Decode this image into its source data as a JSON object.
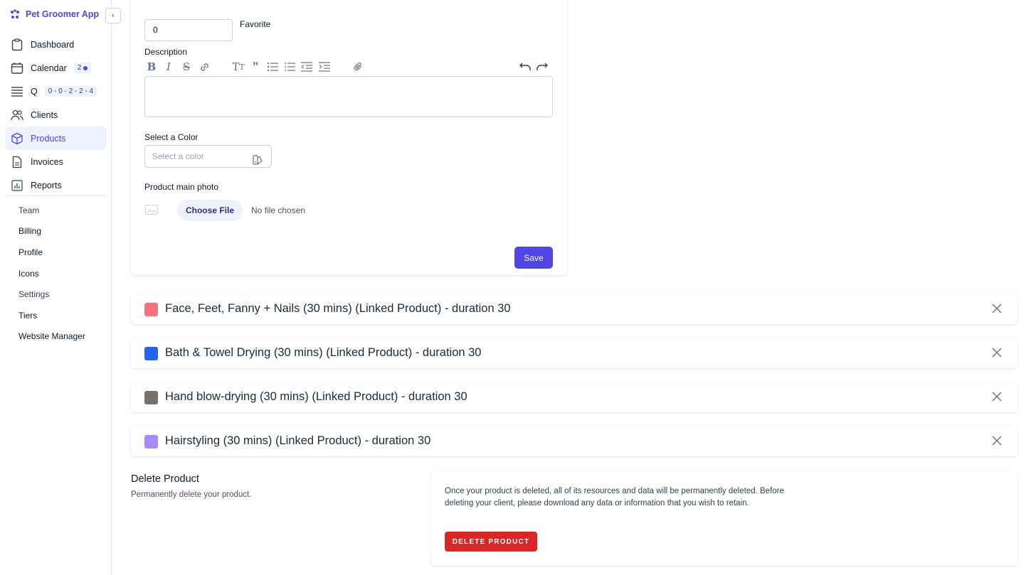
{
  "app": {
    "title": "Pet Groomer App",
    "collapse_icon": "chevron-left-icon",
    "brand_color": "#4f46e5"
  },
  "nav": {
    "items": [
      {
        "label": "Dashboard",
        "icon": "clipboard-icon"
      },
      {
        "label": "Calendar",
        "icon": "calendar-icon",
        "badge": "2"
      },
      {
        "label": "Q",
        "icon": "queue-icon",
        "badge": "0 - 0 - 2 - 2 - 4"
      },
      {
        "label": "Clients",
        "icon": "users-icon"
      },
      {
        "label": "Products",
        "icon": "cube-icon",
        "active": true
      },
      {
        "label": "Invoices",
        "icon": "document-icon"
      },
      {
        "label": "Reports",
        "icon": "chart-icon"
      }
    ],
    "sub_items": [
      "Team",
      "Billing",
      "Profile",
      "Icons",
      "Settings",
      "Tiers",
      "Website Manager"
    ]
  },
  "form": {
    "favorite_value": "0",
    "favorite_label": "Favorite",
    "description_label": "Description",
    "toolbar_icons": [
      "bold-icon",
      "italic-icon",
      "strikethrough-icon",
      "link-icon",
      "heading-icon",
      "quote-icon",
      "bullet-list-icon",
      "numbered-list-icon",
      "outdent-icon",
      "indent-icon",
      "attachment-icon",
      "undo-icon",
      "redo-icon"
    ],
    "color_label": "Select a Color",
    "color_placeholder": "Select a color",
    "photo_label": "Product main photo",
    "choose_file": "Choose File",
    "no_file": "No file chosen",
    "save": "Save"
  },
  "linked_products": [
    {
      "title": "Face, Feet, Fanny + Nails (30 mins) (Linked Product) - duration 30",
      "color": "#f87181"
    },
    {
      "title": "Bath & Towel Drying (30 mins) (Linked Product) - duration 30",
      "color": "#2563eb"
    },
    {
      "title": "Hand blow-drying (30 mins) (Linked Product) - duration 30",
      "color": "#78706a"
    },
    {
      "title": "Hairstyling (30 mins) (Linked Product) - duration 30",
      "color": "#a78bfa"
    }
  ],
  "delete": {
    "title": "Delete Product",
    "subtitle": "Permanently delete your product.",
    "warning": "Once your product is deleted, all of its resources and data will be permanently deleted. Before deleting your client, please download any data or information that you wish to retain.",
    "button": "DELETE PRODUCT"
  }
}
